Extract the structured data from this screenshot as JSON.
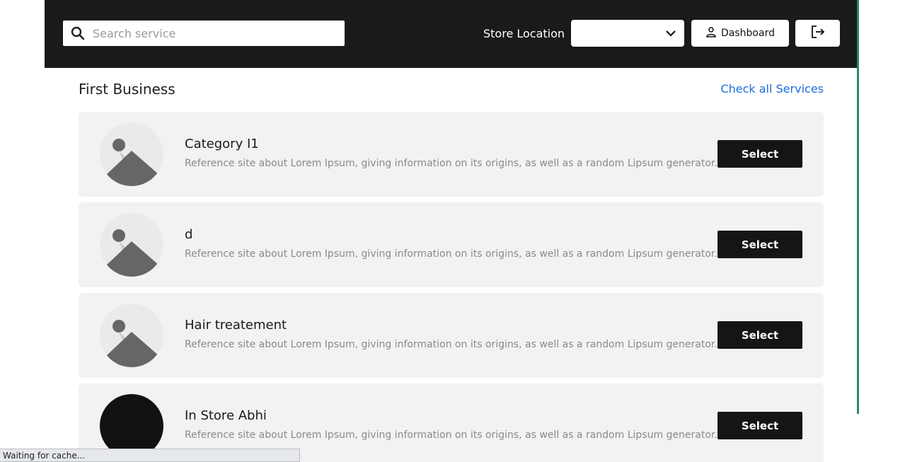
{
  "header": {
    "search": {
      "placeholder": "Search service",
      "value": ""
    },
    "store_location_label": "Store Location",
    "store_location_value": "",
    "dashboard_label": "Dashboard"
  },
  "section": {
    "title": "First Business",
    "check_all_label": "Check all Services"
  },
  "services": [
    {
      "name": "Category I1",
      "description": "Reference site about Lorem Ipsum, giving information on its origins, as well as a random Lipsum generator.",
      "select_label": "Select",
      "image": "placeholder-image"
    },
    {
      "name": "d",
      "description": "Reference site about Lorem Ipsum, giving information on its origins, as well as a random Lipsum generator.",
      "select_label": "Select",
      "image": "placeholder-image"
    },
    {
      "name": "Hair treatement",
      "description": "Reference site about Lorem Ipsum, giving information on its origins, as well as a random Lipsum generator.",
      "select_label": "Select",
      "image": "placeholder-image"
    },
    {
      "name": "In Store Abhi",
      "description": "Reference site about Lorem Ipsum, giving information on its origins, as well as a random Lipsum generator.",
      "select_label": "Select",
      "image": "dark-image"
    }
  ],
  "status_bar": {
    "text": "Waiting for cache..."
  },
  "colors": {
    "header_bg": "#1a1a1a",
    "link": "#1a6fdc",
    "button_bg": "#151515",
    "card_bg": "#f2f2f2",
    "accent_line": "#2e8b6e"
  }
}
